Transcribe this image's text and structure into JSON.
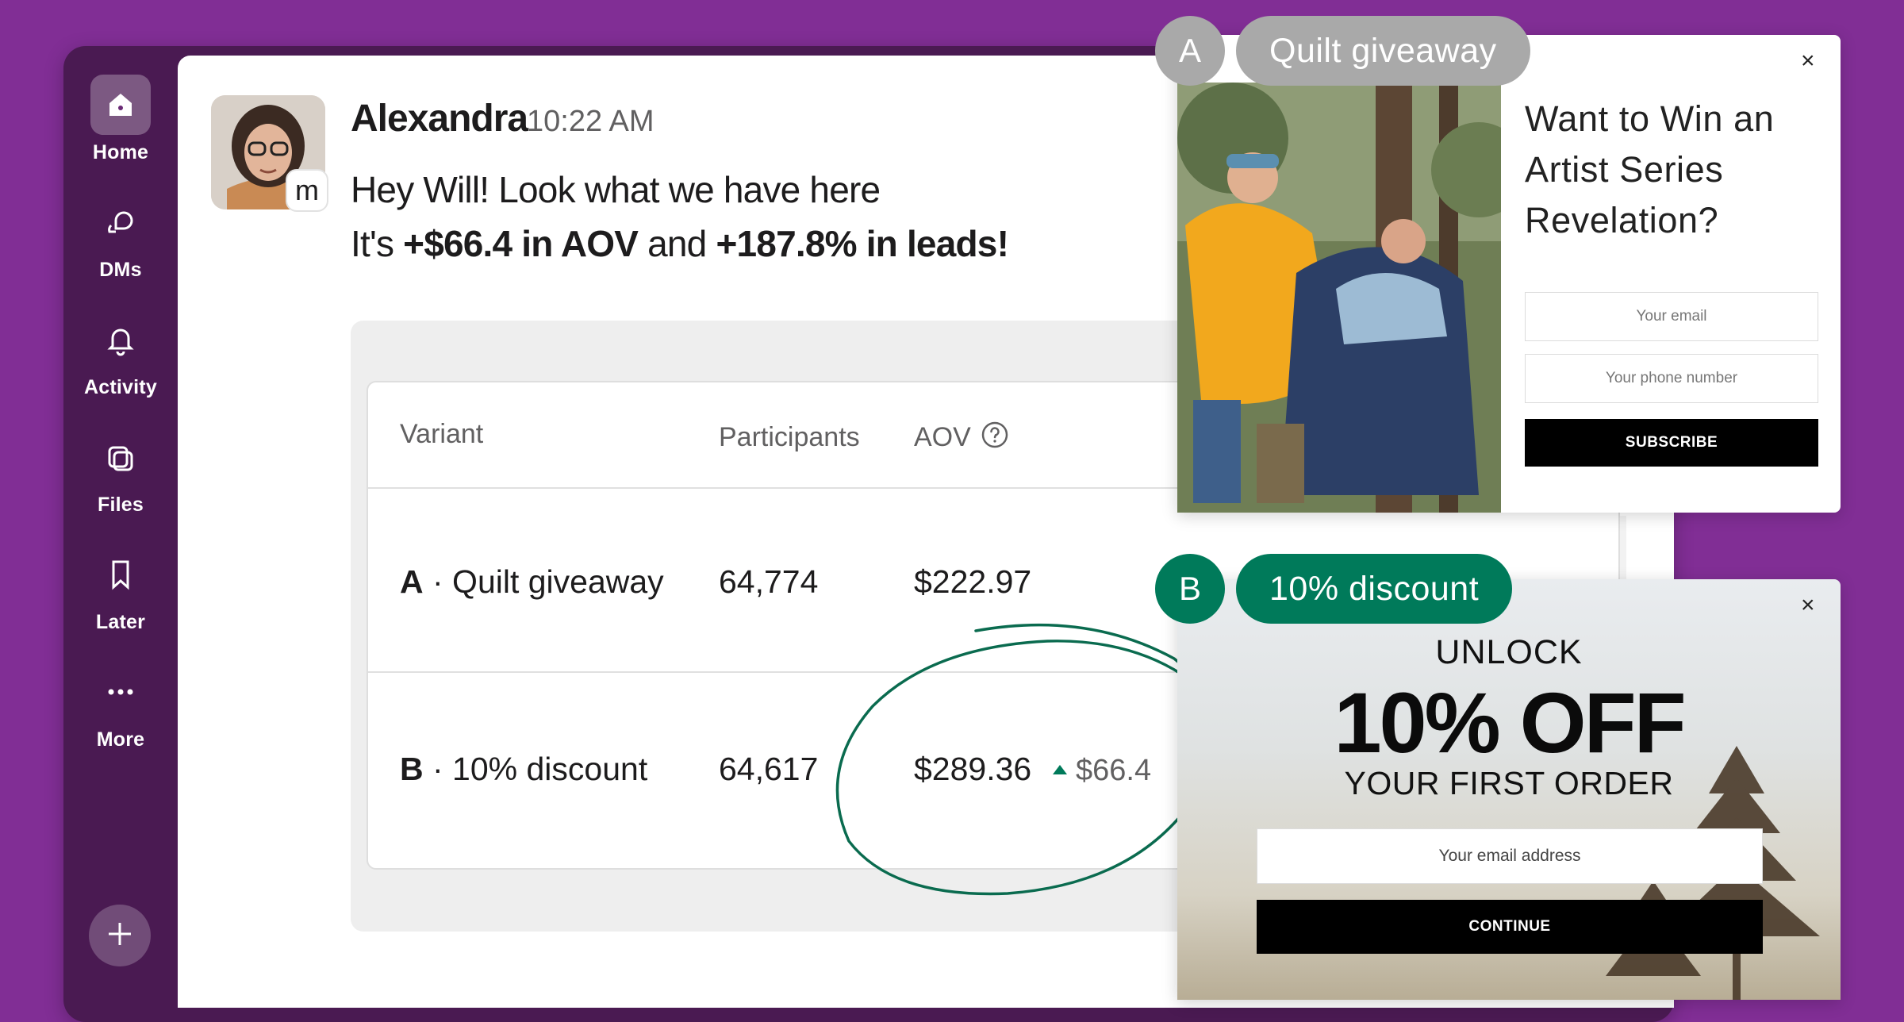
{
  "sidebar": {
    "items": [
      {
        "label": "Home",
        "icon": "home-icon",
        "active": true
      },
      {
        "label": "DMs",
        "icon": "dms-icon"
      },
      {
        "label": "Activity",
        "icon": "bell-icon"
      },
      {
        "label": "Files",
        "icon": "files-icon"
      },
      {
        "label": "Later",
        "icon": "bookmark-icon"
      },
      {
        "label": "More",
        "icon": "more-icon"
      }
    ],
    "add_icon": "plus-icon"
  },
  "message": {
    "sender": "Alexandra",
    "time": "10:22 AM",
    "app_badge": "m",
    "line1": "Hey Will! Look what we have here",
    "line2_prefix": "It's ",
    "line2_bold1": "+$66.4 in AOV",
    "line2_mid": " and ",
    "line2_bold2": "+187.8% in leads!"
  },
  "results": {
    "headers": {
      "variant": "Variant",
      "participants": "Participants",
      "aov": "AOV"
    },
    "rows": [
      {
        "letter": "A",
        "sep": " · ",
        "name": "Quilt giveaway",
        "participants": "64,774",
        "aov": "$222.97"
      },
      {
        "letter": "B",
        "sep": " · ",
        "name": "10% discount",
        "participants": "64,617",
        "aov": "$289.36",
        "uplift": "$66.4"
      }
    ]
  },
  "popup_a": {
    "tag_letter": "A",
    "tag_label": "Quilt giveaway",
    "heading": "Want to Win an Artist Series Revelation?",
    "email_placeholder": "Your email",
    "phone_placeholder": "Your phone number",
    "button": "SUBSCRIBE",
    "close": "×"
  },
  "popup_b": {
    "tag_letter": "B",
    "tag_label": "10% discount",
    "eyebrow": "UNLOCK",
    "headline": "10% OFF",
    "subhead": "YOUR FIRST ORDER",
    "email_placeholder": "Your email address",
    "button": "CONTINUE",
    "close": "×"
  },
  "colors": {
    "background": "#812e95",
    "sidebar": "#4a1a52",
    "accent_green": "#007a5a",
    "tag_grey": "#a9a9a9"
  }
}
